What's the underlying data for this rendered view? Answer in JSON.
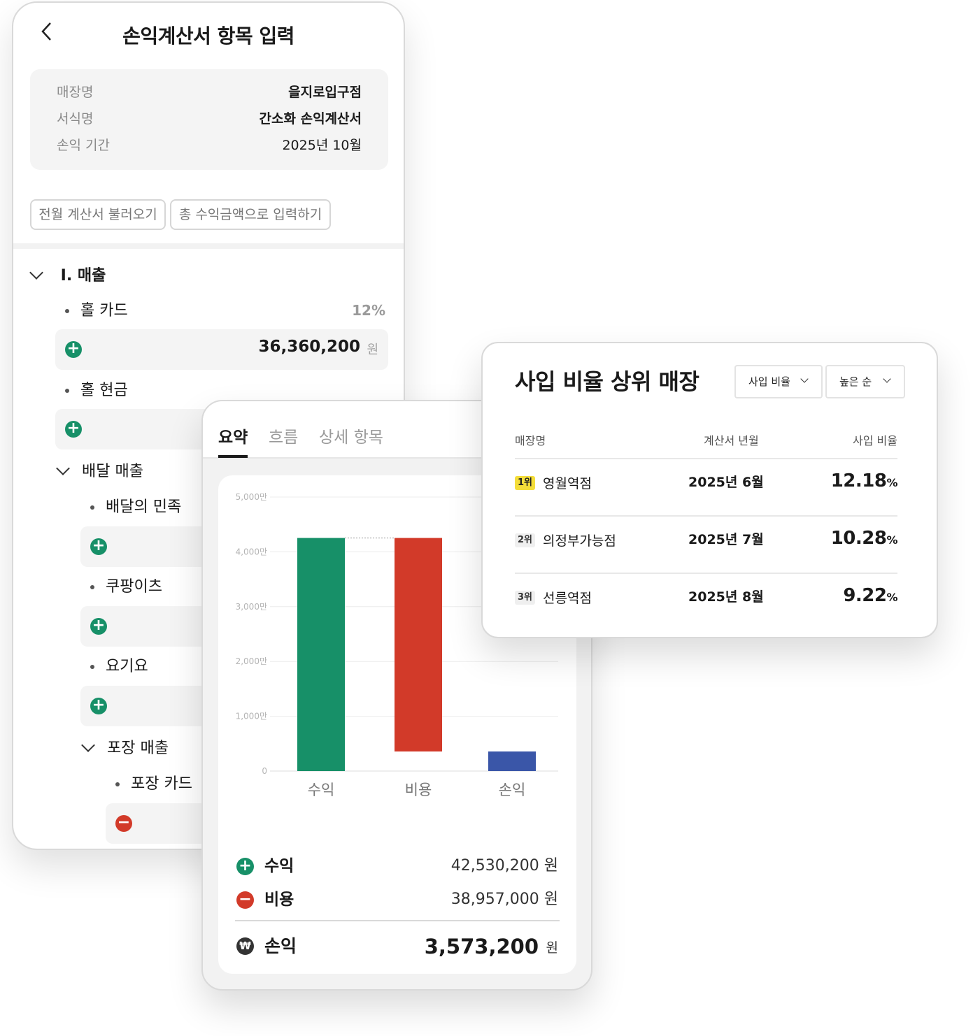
{
  "input_screen": {
    "title": "손익계산서 항목 입력",
    "info": [
      {
        "key": "매장명",
        "value": "을지로입구점"
      },
      {
        "key": "서식명",
        "value": "간소화 손익계산서"
      },
      {
        "key": "손익 기간",
        "value": "2025년 10월"
      }
    ],
    "buttons": {
      "load_prev": "전월 계산서 불러오기",
      "input_total": "총 수익금액으로 입력하기"
    },
    "section_title": "I. 매출",
    "items": {
      "hall_card": "홀 카드",
      "hall_card_pct": "12%",
      "hall_card_amount": "36,360,200",
      "unit": "원",
      "hall_cash": "홀 현금",
      "delivery": "배달 매출",
      "baemin": "배달의 민족",
      "coupang": "쿠팡이츠",
      "yogiyo": "요기요",
      "takeout": "포장 매출",
      "takeout_card": "포장 카드"
    }
  },
  "summary_screen": {
    "tabs": [
      "요약",
      "흐름",
      "상세 항목"
    ],
    "rows": {
      "income_label": "수익",
      "income_value": "42,530,200 원",
      "expense_label": "비용",
      "expense_value": "38,957,000 원",
      "profit_label": "손익",
      "profit_value": "3,573,200",
      "profit_unit": "원"
    }
  },
  "chart_data": {
    "type": "bar",
    "subtype": "waterfall",
    "categories": [
      "수익",
      "비용",
      "손익"
    ],
    "values": [
      42530200,
      38957000,
      3573200
    ],
    "bars": [
      {
        "category": "수익",
        "start": 0,
        "end": 42530200,
        "color": "#179068"
      },
      {
        "category": "비용",
        "start": 3573200,
        "end": 42530200,
        "color": "#d23a29"
      },
      {
        "category": "손익",
        "start": 0,
        "end": 3573200,
        "color": "#3a56a8"
      }
    ],
    "yticks": [
      "0",
      "1,000만",
      "2,000만",
      "3,000만",
      "4,000만",
      "5,000만"
    ],
    "ylim": [
      0,
      50000000
    ],
    "grid": true
  },
  "ranking_screen": {
    "title": "사입 비율 상위 매장",
    "filter1": "사입 비율",
    "filter2": "높은 순",
    "headers": {
      "store": "매장명",
      "month": "계산서 년월",
      "ratio": "사입 비율"
    },
    "rows": [
      {
        "rank": "1위",
        "store": "영월역점",
        "month": "2025년 6월",
        "ratio": "12.18",
        "pct": "%"
      },
      {
        "rank": "2위",
        "store": "의정부가능점",
        "month": "2025년 7월",
        "ratio": "10.28",
        "pct": "%"
      },
      {
        "rank": "3위",
        "store": "선릉역점",
        "month": "2025년 8월",
        "ratio": "9.22",
        "pct": "%"
      }
    ]
  },
  "colors": {
    "income": "#179068",
    "expense": "#d23a29",
    "profit": "#3a56a8",
    "rank1_badge": "#f4dd3a"
  }
}
